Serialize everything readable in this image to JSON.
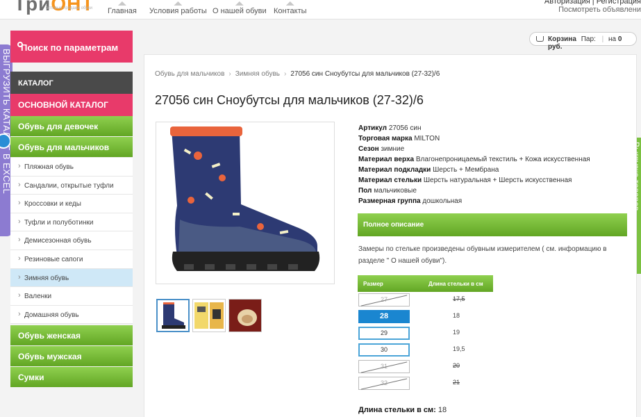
{
  "header": {
    "logo_main": "Три",
    "logo_accent": "ОНТ",
    "logo_sub": "оптовые продажи обуви",
    "nav": [
      {
        "label": "Главная"
      },
      {
        "label": "Условия работы"
      },
      {
        "label": "О нашей обуви"
      },
      {
        "label": "Контакты"
      }
    ],
    "auth": "Авторизация | Регистрация",
    "recent": "Посмотреть объявлени"
  },
  "side_tabs": {
    "left": "ВЫГРУЗИТЬ КАТАЛОГ В EXCEL",
    "right": "Выгрузка товаров"
  },
  "sidebar": {
    "search": "Поиск по параметрам",
    "catalog": "КАТАЛОГ",
    "main_catalog": "ОСНОВНОЙ КАТАЛОГ",
    "girls": "Обувь для девочек",
    "boys": "Обувь для мальчиков",
    "sub_items": [
      {
        "label": "Пляжная обувь"
      },
      {
        "label": "Сандалии, открытые туфли"
      },
      {
        "label": "Кроссовки и кеды"
      },
      {
        "label": "Туфли и полуботинки"
      },
      {
        "label": "Демисезонная обувь"
      },
      {
        "label": "Резиновые сапоги"
      },
      {
        "label": "Зимняя обувь"
      },
      {
        "label": "Валенки"
      },
      {
        "label": "Домашняя обувь"
      }
    ],
    "women": "Обувь женская",
    "men": "Обувь мужская",
    "bags": "Сумки"
  },
  "basket": {
    "label": "Корзина",
    "pairs_label": "Пар:",
    "sum_label": "на",
    "sum": "0 руб."
  },
  "breadcrumb": {
    "items": [
      "Обувь для мальчиков",
      "Зимняя обувь"
    ],
    "current": "27056 син Сноубутсы для мальчиков (27-32)/6"
  },
  "product": {
    "title": "27056 син Сноубутсы для мальчиков (27-32)/6",
    "props": [
      {
        "label": "Артикул",
        "value": "27056 син"
      },
      {
        "label": "Торговая марка",
        "value": "MILTON"
      },
      {
        "label": "Сезон",
        "value": "зимние"
      },
      {
        "label": "Материал верха",
        "value": "Влагонепроницаемый текстиль + Кожа искусственная"
      },
      {
        "label": "Материал подкладки",
        "value": "Шерсть + Мембрана"
      },
      {
        "label": "Материал стельки",
        "value": "Шерсть натуральная + Шерсть искусственная"
      },
      {
        "label": "Пол",
        "value": "мальчиковые"
      },
      {
        "label": "Размерная группа",
        "value": "дошкольная"
      }
    ],
    "full_desc_label": "Полное описание",
    "desc": "Замеры по стельке произведены обувным измерителем ( см. информацию в разделе \" О нашей обуви\").",
    "size_header": {
      "size": "Размер",
      "length": "Длина стельки в см"
    },
    "sizes": [
      {
        "size": "27",
        "length": "17,5",
        "state": "na"
      },
      {
        "size": "28",
        "length": "18",
        "state": "sel"
      },
      {
        "size": "29",
        "length": "19",
        "state": "avail"
      },
      {
        "size": "30",
        "length": "19,5",
        "state": "avail"
      },
      {
        "size": "31",
        "length": "20",
        "state": "na"
      },
      {
        "size": "32",
        "length": "21",
        "state": "na"
      }
    ],
    "len_label": "Длина стельки в см:",
    "len_value": "18"
  },
  "colors": {
    "green": "#6fb52e",
    "pink": "#e83a6a",
    "blue": "#1a86d0",
    "dark": "#4a4a4a"
  }
}
